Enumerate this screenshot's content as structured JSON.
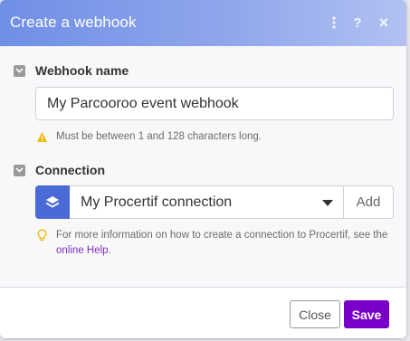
{
  "dialog": {
    "title": "Create a webhook",
    "header_icons": [
      "more-vertical-icon",
      "help-icon",
      "close-icon"
    ],
    "header_help_glyph": "?",
    "header_close_glyph": "×"
  },
  "webhook_name": {
    "label": "Webhook name",
    "value": "My Parcooroo event webhook",
    "hint": "Must be between 1 and 128 characters long."
  },
  "connection": {
    "label": "Connection",
    "selected": "My Procertif connection",
    "add_label": "Add",
    "info_text": "For more information on how to create a connection to Procertif, see the",
    "help_link": "online Help",
    "info_suffix": "."
  },
  "footer": {
    "close_label": "Close",
    "save_label": "Save"
  },
  "colors": {
    "header_gradient_start": "#6f8fe5",
    "accent_purple": "#7a00c9",
    "connection_badge": "#4a6bd6",
    "warning_yellow": "#f2b705"
  }
}
